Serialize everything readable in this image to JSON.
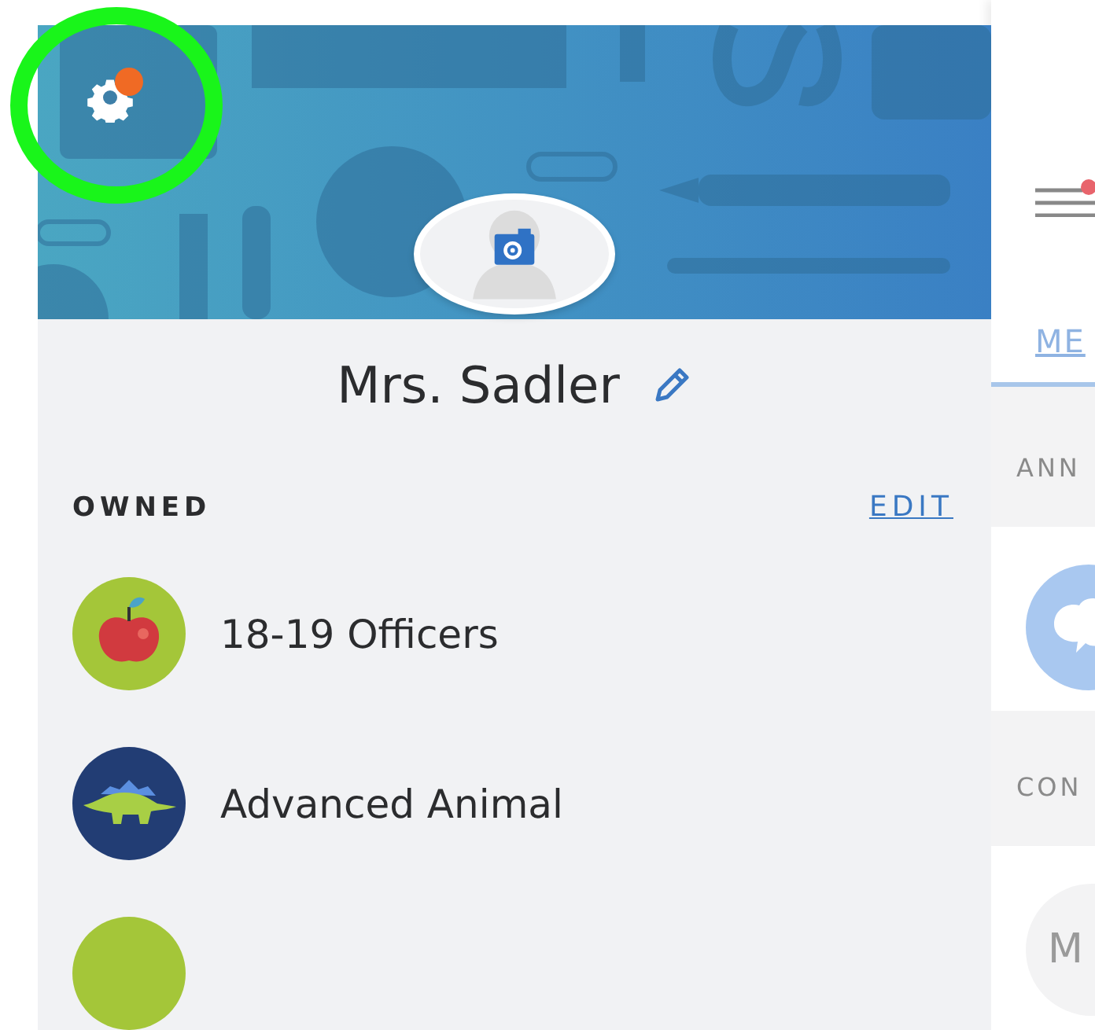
{
  "settings": {
    "notification": true
  },
  "profile": {
    "name": "Mrs. Sadler"
  },
  "owned": {
    "heading": "OWNED",
    "action": "EDIT",
    "classes": [
      {
        "kind": "apple",
        "name": "18-19 Officers"
      },
      {
        "kind": "stegosaurus",
        "name": "Advanced Animal"
      },
      {
        "kind": "plain"
      }
    ]
  },
  "side_panel": {
    "menu_notification": true,
    "tab": "ME",
    "sections": [
      {
        "heading": "ANN",
        "kind": "announcement"
      },
      {
        "heading": "CON",
        "kind": "contact",
        "avatar_text": "M"
      }
    ]
  }
}
